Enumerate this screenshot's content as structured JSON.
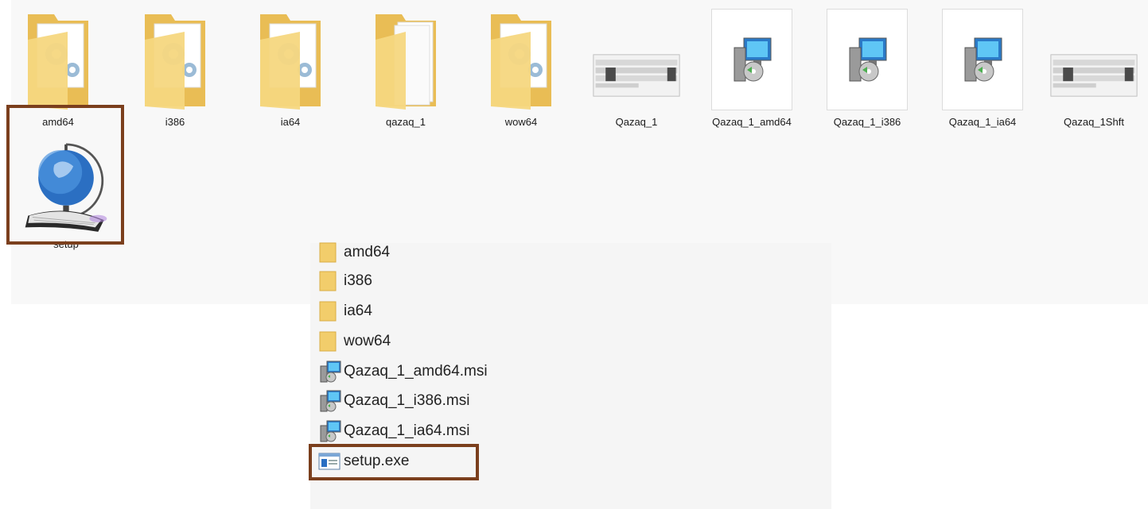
{
  "large_icons": [
    {
      "label": "amd64",
      "type": "folder-settings"
    },
    {
      "label": "i386",
      "type": "folder-settings"
    },
    {
      "label": "ia64",
      "type": "folder-settings"
    },
    {
      "label": "qazaq_1",
      "type": "folder-docs"
    },
    {
      "label": "wow64",
      "type": "folder-settings"
    },
    {
      "label": "Qazaq_1",
      "type": "keyboard-thumbnail"
    },
    {
      "label": "Qazaq_1_amd64",
      "type": "msi-installer"
    },
    {
      "label": "Qazaq_1_i386",
      "type": "msi-installer"
    },
    {
      "label": "Qazaq_1_ia64",
      "type": "msi-installer"
    },
    {
      "label": "Qazaq_1Shft",
      "type": "keyboard-thumbnail"
    }
  ],
  "setup_icon": {
    "label": "setup",
    "type": "globe-keyboard"
  },
  "list_items": [
    {
      "label": "amd64",
      "type": "folder"
    },
    {
      "label": "i386",
      "type": "folder"
    },
    {
      "label": "ia64",
      "type": "folder"
    },
    {
      "label": "wow64",
      "type": "folder"
    },
    {
      "label": "Qazaq_1_amd64.msi",
      "type": "msi"
    },
    {
      "label": "Qazaq_1_i386.msi",
      "type": "msi"
    },
    {
      "label": "Qazaq_1_ia64.msi",
      "type": "msi"
    },
    {
      "label": "setup.exe",
      "type": "exe"
    }
  ],
  "colors": {
    "highlight": "#7b3f1d",
    "folder": "#f2cd6b",
    "panel_bg": "#f8f8f8"
  }
}
